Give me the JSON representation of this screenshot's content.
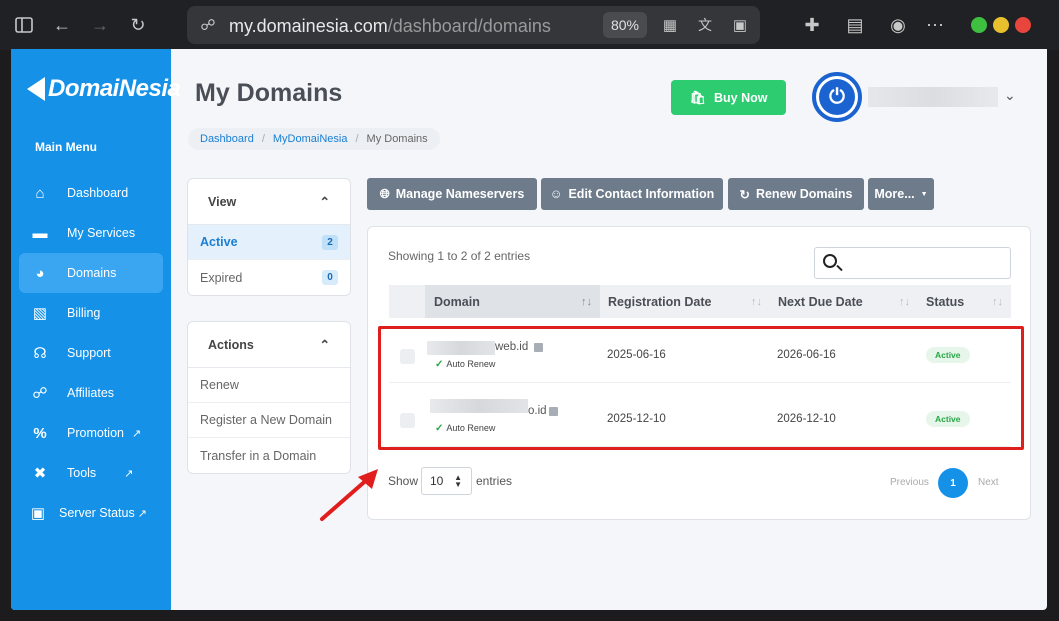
{
  "browser": {
    "url_host": "my.domainesia.com",
    "url_path": "/dashboard/domains",
    "zoom": "80%"
  },
  "sidebar": {
    "logo": "DomaiNesia",
    "main_menu_label": "Main Menu",
    "items": [
      {
        "label": "Dashboard",
        "icon": "home-icon"
      },
      {
        "label": "My Services",
        "icon": "server-icon"
      },
      {
        "label": "Domains",
        "icon": "globe-icon",
        "active": true
      },
      {
        "label": "Billing",
        "icon": "receipt-icon"
      },
      {
        "label": "Support",
        "icon": "headset-icon"
      },
      {
        "label": "Affiliates",
        "icon": "handshake-icon"
      },
      {
        "label": "Promotion",
        "icon": "percent-icon",
        "external": true
      },
      {
        "label": "Tools",
        "icon": "tools-icon",
        "external": true
      },
      {
        "label": "Server Status",
        "icon": "monitor-icon",
        "external": true
      }
    ]
  },
  "header": {
    "title": "My Domains",
    "buy_label": "Buy Now"
  },
  "breadcrumb": [
    "Dashboard",
    "MyDomaiNesia",
    "My Domains"
  ],
  "view_panel": {
    "title": "View",
    "items": [
      {
        "label": "Active",
        "count": "2"
      },
      {
        "label": "Expired",
        "count": "0"
      }
    ]
  },
  "actions_panel": {
    "title": "Actions",
    "items": [
      "Renew",
      "Register a New Domain",
      "Transfer in a Domain"
    ]
  },
  "toolbar": {
    "manage_ns": "Manage Nameservers",
    "edit_contact": "Edit Contact Information",
    "renew": "Renew Domains",
    "more": "More..."
  },
  "table": {
    "showing": "Showing 1 to 2 of 2 entries",
    "columns": [
      "Domain",
      "Registration Date",
      "Next Due Date",
      "Status"
    ],
    "rows": [
      {
        "domain_suffix": "web.id",
        "auto_renew": "Auto Renew",
        "registration": "2025-06-16",
        "due": "2026-06-16",
        "status": "Active"
      },
      {
        "domain_suffix": "o.id",
        "auto_renew": "Auto Renew",
        "registration": "2025-12-10",
        "due": "2026-12-10",
        "status": "Active"
      }
    ],
    "show_label": "Show",
    "entries_value": "10",
    "entries_label": "entries",
    "prev": "Previous",
    "page": "1",
    "next": "Next"
  },
  "colors": {
    "sidebar": "#1591e8",
    "buy": "#2ecc71",
    "highlight": "#e01e1e",
    "toolbar_btn": "#6e7b8b"
  }
}
